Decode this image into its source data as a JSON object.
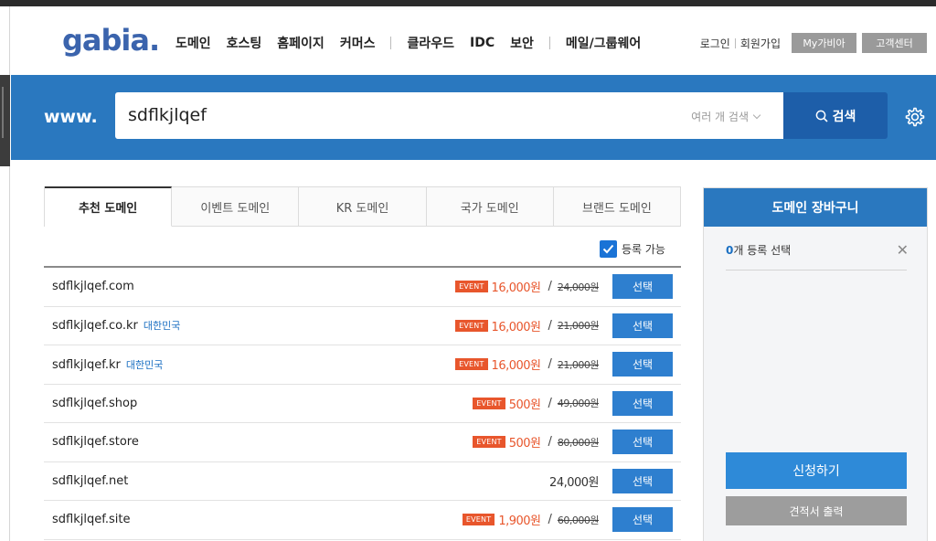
{
  "header": {
    "logo": "gabia.",
    "nav": [
      "도메인",
      "호스팅",
      "홈페이지",
      "커머스",
      "클라우드",
      "IDC",
      "보안",
      "메일/그룹웨어"
    ],
    "util": {
      "login": "로그인",
      "signup": "회원가입",
      "mygabia": "My가비아",
      "support": "고객센터"
    }
  },
  "search": {
    "prefix": "www.",
    "value": "sdflkjlqef",
    "multi_label": "여러 개 검색",
    "button_label": "검색"
  },
  "tabs": [
    "추천 도메인",
    "이벤트 도메인",
    "KR 도메인",
    "국가 도메인",
    "브랜드 도메인"
  ],
  "filter_label": "등록 가능",
  "results": [
    {
      "domain": "sdflkjlqef.com",
      "country": "",
      "event": "EVENT",
      "price": "16,000원",
      "original": "24,000원",
      "button": "선택"
    },
    {
      "domain": "sdflkjlqef.co.kr",
      "country": "대한민국",
      "event": "EVENT",
      "price": "16,000원",
      "original": "21,000원",
      "button": "선택"
    },
    {
      "domain": "sdflkjlqef.kr",
      "country": "대한민국",
      "event": "EVENT",
      "price": "16,000원",
      "original": "21,000원",
      "button": "선택"
    },
    {
      "domain": "sdflkjlqef.shop",
      "country": "",
      "event": "EVENT",
      "price": "500원",
      "original": "49,000원",
      "button": "선택"
    },
    {
      "domain": "sdflkjlqef.store",
      "country": "",
      "event": "EVENT",
      "price": "500원",
      "original": "80,000원",
      "button": "선택"
    },
    {
      "domain": "sdflkjlqef.net",
      "country": "",
      "event": "",
      "price": "24,000원",
      "original": "",
      "button": "선택"
    },
    {
      "domain": "sdflkjlqef.site",
      "country": "",
      "event": "EVENT",
      "price": "1,900원",
      "original": "60,000원",
      "button": "선택"
    }
  ],
  "cart": {
    "title": "도메인 장바구니",
    "count": "0",
    "count_suffix": "개 등록 선택",
    "apply_label": "신청하기",
    "quote_label": "견적서 출력"
  },
  "colors": {
    "brand_blue": "#2a78bf",
    "event_orange": "#e8562c"
  }
}
